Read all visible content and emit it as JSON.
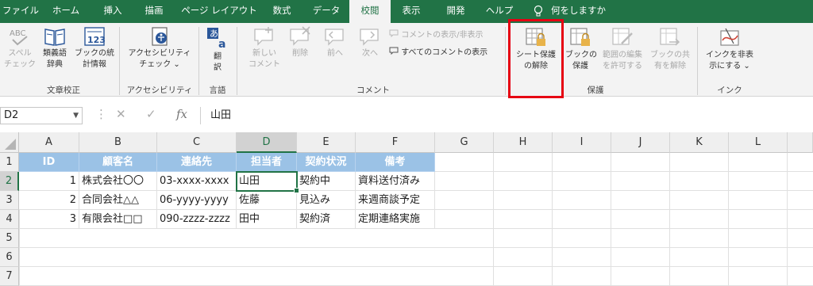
{
  "tabs": [
    {
      "label": "ファイル",
      "active": false
    },
    {
      "label": "ホーム",
      "active": false
    },
    {
      "label": "挿入",
      "active": false
    },
    {
      "label": "描画",
      "active": false
    },
    {
      "label": "ページ レイアウト",
      "active": false
    },
    {
      "label": "数式",
      "active": false
    },
    {
      "label": "データ",
      "active": false
    },
    {
      "label": "校閲",
      "active": true
    },
    {
      "label": "表示",
      "active": false
    },
    {
      "label": "開発",
      "active": false
    },
    {
      "label": "ヘルプ",
      "active": false
    }
  ],
  "tell_me": "何をしますか",
  "ribbon": {
    "proofing": {
      "spell_1": "スペル",
      "spell_2": "チェック",
      "thesaurus_1": "類義語",
      "thesaurus_2": "辞典",
      "stats_1": "ブックの統",
      "stats_2": "計情報",
      "group": "文章校正"
    },
    "accessibility": {
      "check_1": "アクセシビリティ",
      "check_2": "チェック ⌄",
      "group": "アクセシビリティ"
    },
    "language": {
      "translate_1": "翻",
      "translate_2": "訳",
      "group": "言語"
    },
    "comments": {
      "new_1": "新しい",
      "new_2": "コメント",
      "delete": "削除",
      "prev": "前へ",
      "next": "次へ",
      "show_hide": "コメントの表示/非表示",
      "show_all": "すべてのコメントの表示",
      "group": "コメント"
    },
    "protect": {
      "unprotect_sheet_1": "シート保護",
      "unprotect_sheet_2": "の解除",
      "protect_book_1": "ブックの",
      "protect_book_2": "保護",
      "allow_edit_1": "範囲の編集",
      "allow_edit_2": "を許可する",
      "unshare_1": "ブックの共",
      "unshare_2": "有を解除",
      "group": "保護"
    },
    "ink": {
      "hide_ink_1": "インクを非表",
      "hide_ink_2": "示にする ⌄",
      "group": "インク"
    }
  },
  "formula_bar": {
    "name_box": "D2",
    "fx": "fx",
    "value": "山田"
  },
  "columns": [
    "A",
    "B",
    "C",
    "D",
    "E",
    "F",
    "G",
    "H",
    "I",
    "J",
    "K",
    "L"
  ],
  "rows": [
    "1",
    "2",
    "3",
    "4",
    "5",
    "6",
    "7"
  ],
  "table": {
    "header": [
      "ID",
      "顧客名",
      "連絡先",
      "担当者",
      "契約状況",
      "備考"
    ],
    "rows": [
      [
        "1",
        "株式会社〇〇",
        "03-xxxx-xxxx",
        "山田",
        "契約中",
        "資料送付済み"
      ],
      [
        "2",
        "合同会社△△",
        "06-yyyy-yyyy",
        "佐藤",
        "見込み",
        "来週商談予定"
      ],
      [
        "3",
        "有限会社□□",
        "090-zzzz-zzzz",
        "田中",
        "契約済",
        "定期連絡実施"
      ]
    ]
  },
  "colors": {
    "excel_green": "#217346",
    "table_header": "#9bc2e6",
    "highlight": "#e60012"
  }
}
